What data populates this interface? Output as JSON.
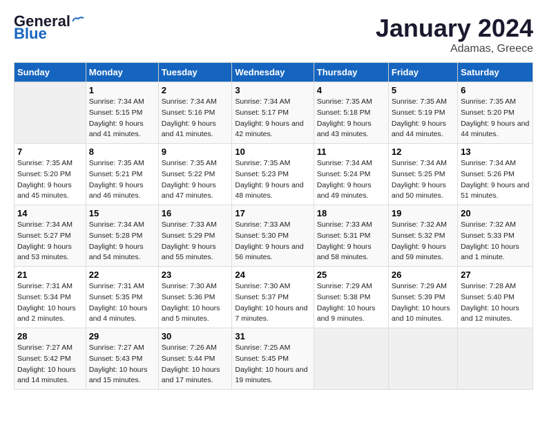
{
  "header": {
    "logo_line1": "General",
    "logo_line2": "Blue",
    "title": "January 2024",
    "subtitle": "Adamas, Greece"
  },
  "days_of_week": [
    "Sunday",
    "Monday",
    "Tuesday",
    "Wednesday",
    "Thursday",
    "Friday",
    "Saturday"
  ],
  "weeks": [
    [
      {
        "day": "",
        "empty": true
      },
      {
        "day": "1",
        "sunrise": "7:34 AM",
        "sunset": "5:15 PM",
        "daylight": "9 hours and 41 minutes."
      },
      {
        "day": "2",
        "sunrise": "7:34 AM",
        "sunset": "5:16 PM",
        "daylight": "9 hours and 41 minutes."
      },
      {
        "day": "3",
        "sunrise": "7:34 AM",
        "sunset": "5:17 PM",
        "daylight": "9 hours and 42 minutes."
      },
      {
        "day": "4",
        "sunrise": "7:35 AM",
        "sunset": "5:18 PM",
        "daylight": "9 hours and 43 minutes."
      },
      {
        "day": "5",
        "sunrise": "7:35 AM",
        "sunset": "5:19 PM",
        "daylight": "9 hours and 44 minutes."
      },
      {
        "day": "6",
        "sunrise": "7:35 AM",
        "sunset": "5:20 PM",
        "daylight": "9 hours and 44 minutes."
      }
    ],
    [
      {
        "day": "7",
        "sunrise": "7:35 AM",
        "sunset": "5:20 PM",
        "daylight": "9 hours and 45 minutes."
      },
      {
        "day": "8",
        "sunrise": "7:35 AM",
        "sunset": "5:21 PM",
        "daylight": "9 hours and 46 minutes."
      },
      {
        "day": "9",
        "sunrise": "7:35 AM",
        "sunset": "5:22 PM",
        "daylight": "9 hours and 47 minutes."
      },
      {
        "day": "10",
        "sunrise": "7:35 AM",
        "sunset": "5:23 PM",
        "daylight": "9 hours and 48 minutes."
      },
      {
        "day": "11",
        "sunrise": "7:34 AM",
        "sunset": "5:24 PM",
        "daylight": "9 hours and 49 minutes."
      },
      {
        "day": "12",
        "sunrise": "7:34 AM",
        "sunset": "5:25 PM",
        "daylight": "9 hours and 50 minutes."
      },
      {
        "day": "13",
        "sunrise": "7:34 AM",
        "sunset": "5:26 PM",
        "daylight": "9 hours and 51 minutes."
      }
    ],
    [
      {
        "day": "14",
        "sunrise": "7:34 AM",
        "sunset": "5:27 PM",
        "daylight": "9 hours and 53 minutes."
      },
      {
        "day": "15",
        "sunrise": "7:34 AM",
        "sunset": "5:28 PM",
        "daylight": "9 hours and 54 minutes."
      },
      {
        "day": "16",
        "sunrise": "7:33 AM",
        "sunset": "5:29 PM",
        "daylight": "9 hours and 55 minutes."
      },
      {
        "day": "17",
        "sunrise": "7:33 AM",
        "sunset": "5:30 PM",
        "daylight": "9 hours and 56 minutes."
      },
      {
        "day": "18",
        "sunrise": "7:33 AM",
        "sunset": "5:31 PM",
        "daylight": "9 hours and 58 minutes."
      },
      {
        "day": "19",
        "sunrise": "7:32 AM",
        "sunset": "5:32 PM",
        "daylight": "9 hours and 59 minutes."
      },
      {
        "day": "20",
        "sunrise": "7:32 AM",
        "sunset": "5:33 PM",
        "daylight": "10 hours and 1 minute."
      }
    ],
    [
      {
        "day": "21",
        "sunrise": "7:31 AM",
        "sunset": "5:34 PM",
        "daylight": "10 hours and 2 minutes."
      },
      {
        "day": "22",
        "sunrise": "7:31 AM",
        "sunset": "5:35 PM",
        "daylight": "10 hours and 4 minutes."
      },
      {
        "day": "23",
        "sunrise": "7:30 AM",
        "sunset": "5:36 PM",
        "daylight": "10 hours and 5 minutes."
      },
      {
        "day": "24",
        "sunrise": "7:30 AM",
        "sunset": "5:37 PM",
        "daylight": "10 hours and 7 minutes."
      },
      {
        "day": "25",
        "sunrise": "7:29 AM",
        "sunset": "5:38 PM",
        "daylight": "10 hours and 9 minutes."
      },
      {
        "day": "26",
        "sunrise": "7:29 AM",
        "sunset": "5:39 PM",
        "daylight": "10 hours and 10 minutes."
      },
      {
        "day": "27",
        "sunrise": "7:28 AM",
        "sunset": "5:40 PM",
        "daylight": "10 hours and 12 minutes."
      }
    ],
    [
      {
        "day": "28",
        "sunrise": "7:27 AM",
        "sunset": "5:42 PM",
        "daylight": "10 hours and 14 minutes."
      },
      {
        "day": "29",
        "sunrise": "7:27 AM",
        "sunset": "5:43 PM",
        "daylight": "10 hours and 15 minutes."
      },
      {
        "day": "30",
        "sunrise": "7:26 AM",
        "sunset": "5:44 PM",
        "daylight": "10 hours and 17 minutes."
      },
      {
        "day": "31",
        "sunrise": "7:25 AM",
        "sunset": "5:45 PM",
        "daylight": "10 hours and 19 minutes."
      },
      {
        "day": "",
        "empty": true
      },
      {
        "day": "",
        "empty": true
      },
      {
        "day": "",
        "empty": true
      }
    ]
  ],
  "labels": {
    "sunrise": "Sunrise:",
    "sunset": "Sunset:",
    "daylight": "Daylight:"
  }
}
